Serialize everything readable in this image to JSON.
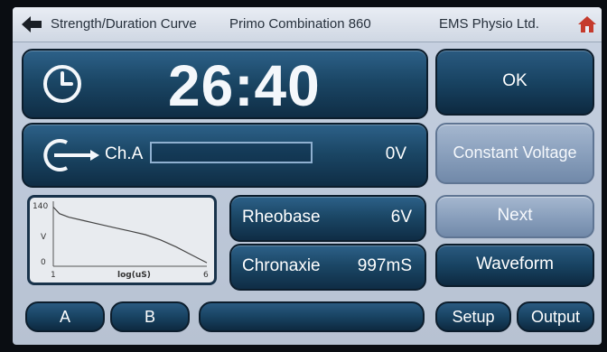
{
  "header": {
    "title": "Strength/Duration Curve",
    "device": "Primo Combination 860",
    "company": "EMS Physio Ltd."
  },
  "timer": {
    "value": "26:40"
  },
  "channel": {
    "label": "Ch.A",
    "voltage": "0V",
    "level": 0
  },
  "buttons": {
    "ok": "OK",
    "constant_voltage": "Constant Voltage",
    "next": "Next",
    "waveform": "Waveform",
    "setup": "Setup",
    "output": "Output",
    "a": "A",
    "b": "B",
    "blank": ""
  },
  "params": {
    "rheobase_label": "Rheobase",
    "rheobase_value": "6V",
    "chronaxie_label": "Chronaxie",
    "chronaxie_value": "997mS"
  },
  "chart_data": {
    "type": "line",
    "xlabel": "log(uS)",
    "ylabel": "V",
    "xlim": [
      1,
      6
    ],
    "ylim": [
      0,
      140
    ],
    "x_ticks": [
      "1",
      "6"
    ],
    "y_ticks": [
      "140",
      "0"
    ],
    "x": [
      1.0,
      1.2,
      1.5,
      2.0,
      2.5,
      3.0,
      3.5,
      4.0,
      4.5,
      5.0,
      5.5,
      6.0
    ],
    "y": [
      135,
      120,
      112,
      104,
      96,
      88,
      80,
      72,
      60,
      44,
      26,
      8
    ],
    "grid": false
  },
  "colors": {
    "panel_dark": "#1b4766",
    "panel_light": "#8aa0bd",
    "screen_bg": "#c5d0df"
  }
}
